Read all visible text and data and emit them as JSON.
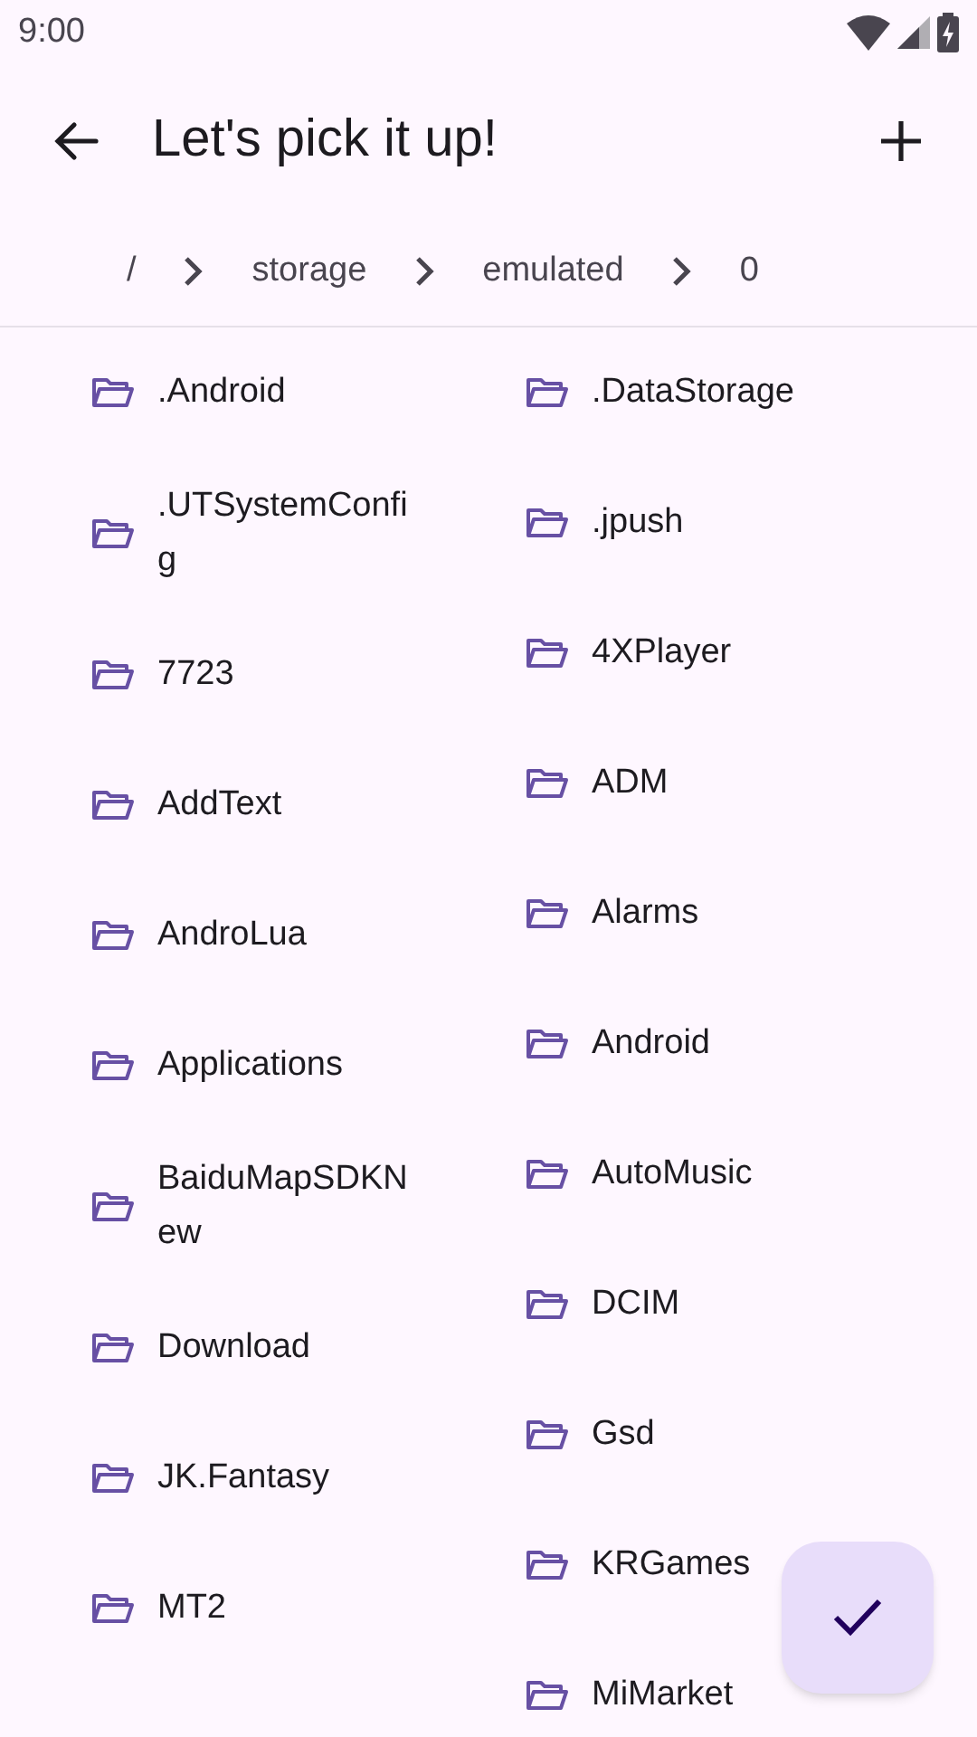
{
  "status_bar": {
    "time": "9:00"
  },
  "app_bar": {
    "title": "Let's pick it up!"
  },
  "breadcrumb": [
    "/",
    "storage",
    "emulated",
    "0"
  ],
  "folder_columns": [
    [
      {
        "name": ".Android"
      },
      {
        "name": ".UTSystemConfig"
      },
      {
        "name": "7723"
      },
      {
        "name": "AddText"
      },
      {
        "name": "AndroLua"
      },
      {
        "name": "Applications"
      },
      {
        "name": "BaiduMapSDKNew"
      },
      {
        "name": "Download"
      },
      {
        "name": "JK.Fantasy"
      },
      {
        "name": "MT2"
      }
    ],
    [
      {
        "name": ".DataStorage"
      },
      {
        "name": ".jpush"
      },
      {
        "name": "4XPlayer"
      },
      {
        "name": "ADM"
      },
      {
        "name": "Alarms"
      },
      {
        "name": "Android"
      },
      {
        "name": "AutoMusic"
      },
      {
        "name": "DCIM"
      },
      {
        "name": "Gsd"
      },
      {
        "name": "KRGames"
      },
      {
        "name": "MiMarket"
      }
    ]
  ]
}
